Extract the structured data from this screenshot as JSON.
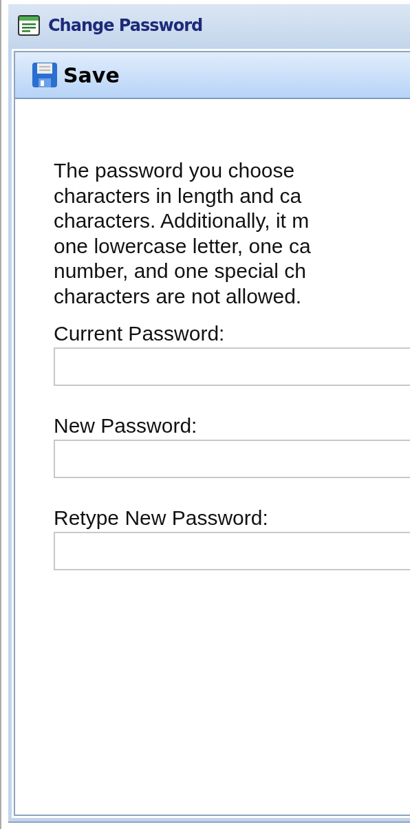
{
  "window": {
    "title": "Change Password"
  },
  "toolbar": {
    "save_button": "Save"
  },
  "instructions": "The password you choose\ncharacters in length and ca\ncharacters. Additionally, it m\none lowercase letter, one ca\nnumber, and one special ch\ncharacters are not allowed.",
  "fields": [
    {
      "label": "Current Password:"
    },
    {
      "label": "New Password:"
    },
    {
      "label": "Retype New Password:"
    }
  ]
}
